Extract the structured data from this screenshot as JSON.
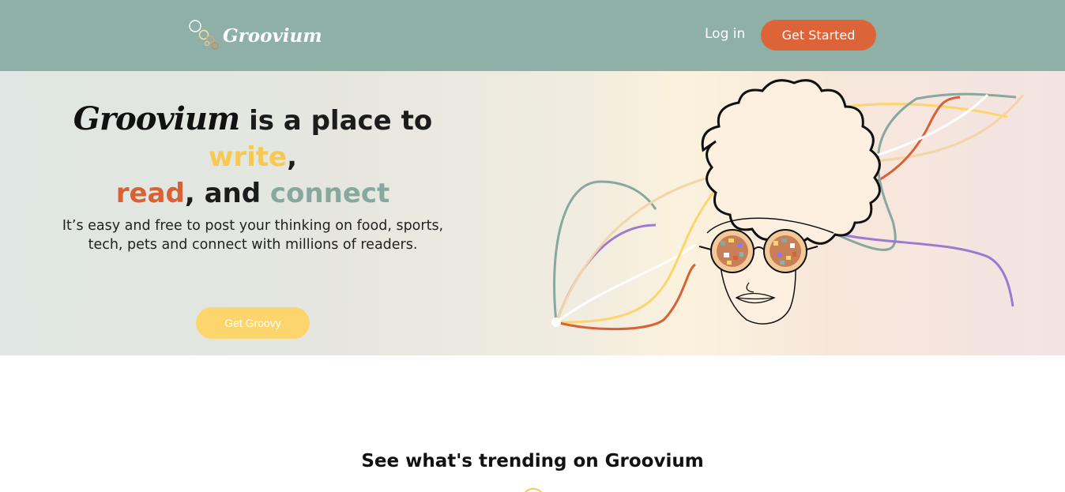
{
  "navbar": {
    "logo_text": "Groovium",
    "login_label": "Log in",
    "get_started_label": "Get Started"
  },
  "hero": {
    "headline": {
      "brand": "Groovium",
      "part1": "is a place to",
      "write": "write",
      "comma1": ",",
      "read": "read",
      "part2": ", and",
      "connect": "connect"
    },
    "subtext": "It’s easy and free to post your thinking on food, sports, tech, pets and connect with millions of readers.",
    "cta_label": "Get Groovy"
  },
  "trending": {
    "title": "See what's trending on Groovium"
  },
  "colors": {
    "navbar_bg": "#8fb0a7",
    "accent_orange": "#dc6438",
    "accent_yellow": "#f7c950",
    "accent_green": "#86a89e",
    "accent_purple": "#9b7bd1"
  },
  "icons": {
    "logo": "bubbles-logo-icon",
    "trending": "circle-icon"
  }
}
